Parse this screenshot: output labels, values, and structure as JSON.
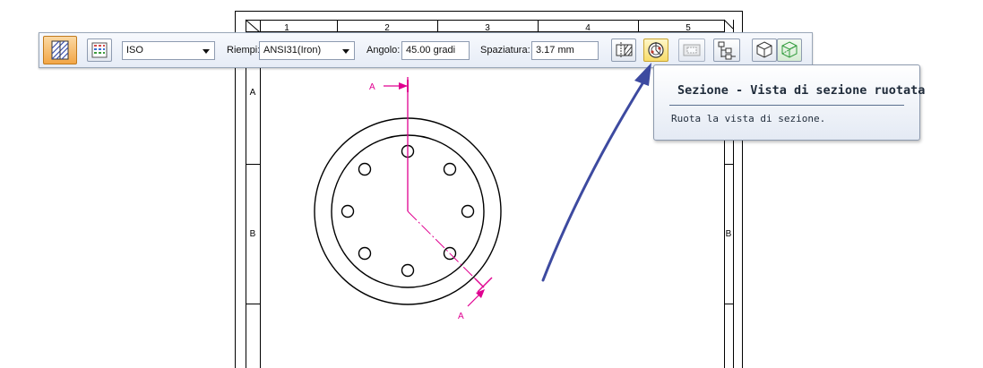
{
  "sheet": {
    "column_numbers": [
      "1",
      "2",
      "3",
      "4",
      "5"
    ],
    "row_letters_left": [
      "A",
      "B"
    ],
    "row_letters_right": [
      "B"
    ],
    "section_label": "A"
  },
  "toolbar": {
    "standard_select": "ISO",
    "fill_label": "Riempi:",
    "fill_value": "ANSI31(Iron)",
    "angle_label": "Angolo:",
    "angle_value": "45.00 gradi",
    "spacing_label": "Spaziatura:",
    "spacing_value": "3.17 mm"
  },
  "tooltip": {
    "title": "Sezione - Vista di sezione ruotata",
    "description": "Ruota la vista di sezione."
  },
  "colors": {
    "section_line": "#e00090",
    "annotation_arrow": "#3d4aa0",
    "active_button": "#f2a646"
  }
}
